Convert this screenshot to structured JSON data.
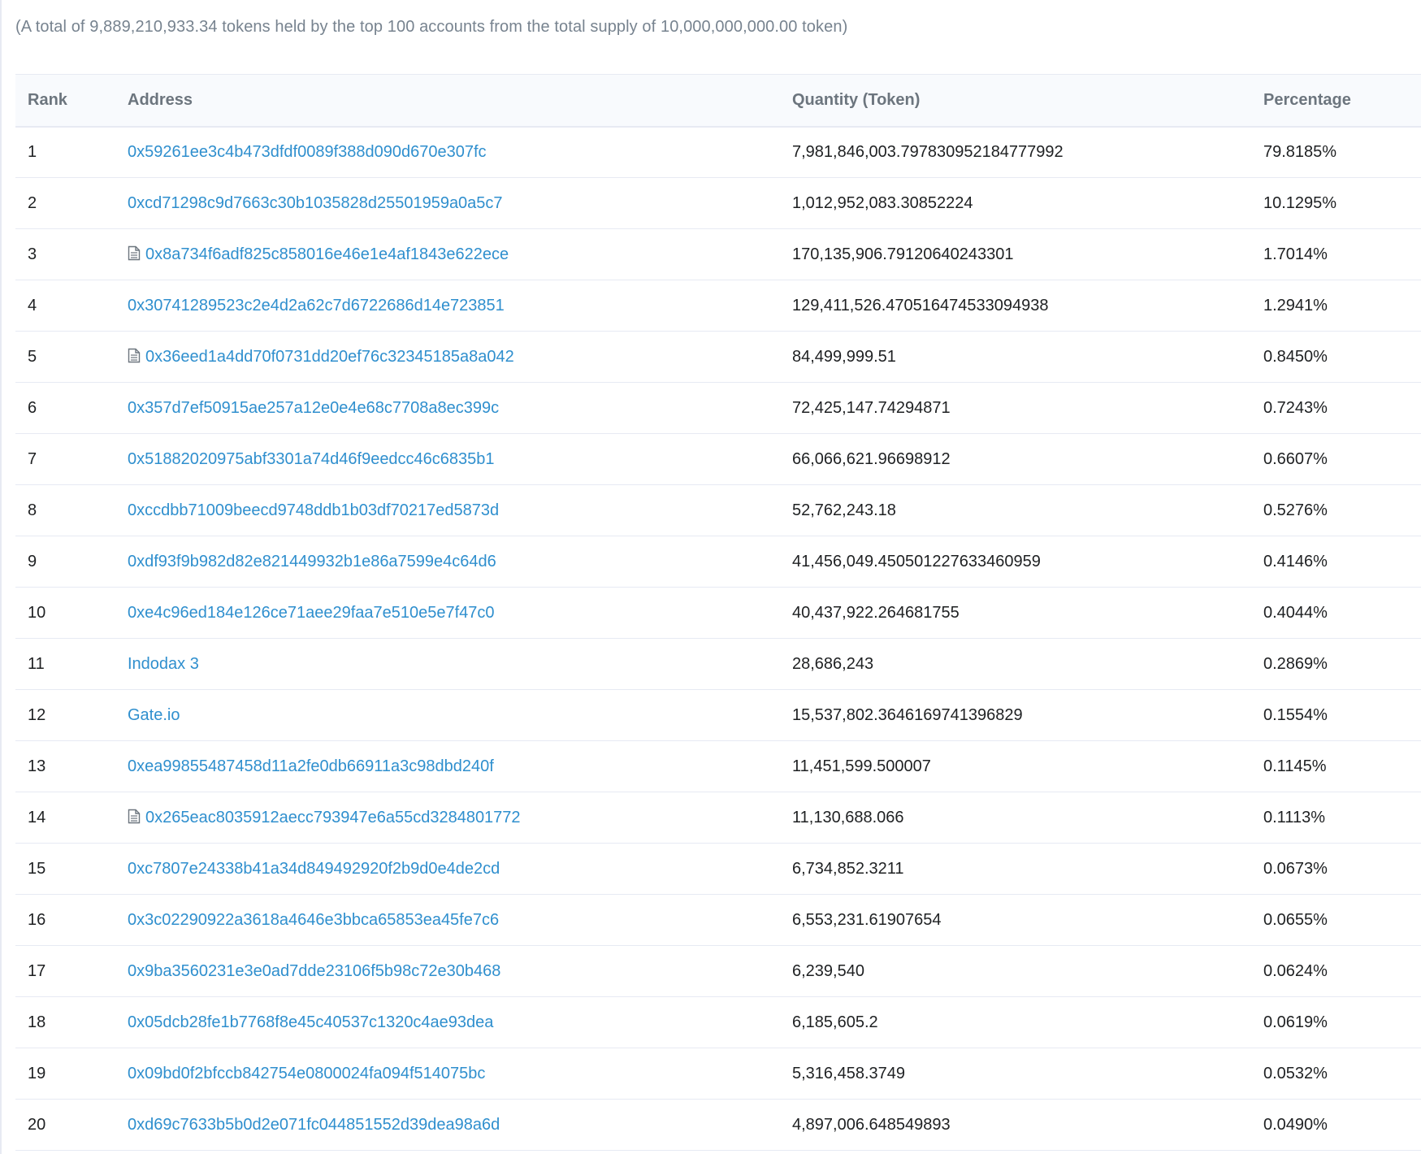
{
  "summary": "(A total of 9,889,210,933.34 tokens held by the top 100 accounts from the total supply of 10,000,000,000.00 token)",
  "table": {
    "headers": {
      "rank": "Rank",
      "address": "Address",
      "quantity": "Quantity (Token)",
      "percentage": "Percentage"
    },
    "rows": [
      {
        "rank": "1",
        "address": "0x59261ee3c4b473dfdf0089f388d090d670e307fc",
        "contract": false,
        "quantity": "7,981,846,003.797830952184777992",
        "percentage": "79.8185%"
      },
      {
        "rank": "2",
        "address": "0xcd71298c9d7663c30b1035828d25501959a0a5c7",
        "contract": false,
        "quantity": "1,012,952,083.30852224",
        "percentage": "10.1295%"
      },
      {
        "rank": "3",
        "address": "0x8a734f6adf825c858016e46e1e4af1843e622ece",
        "contract": true,
        "quantity": "170,135,906.79120640243301",
        "percentage": "1.7014%"
      },
      {
        "rank": "4",
        "address": "0x30741289523c2e4d2a62c7d6722686d14e723851",
        "contract": false,
        "quantity": "129,411,526.470516474533094938",
        "percentage": "1.2941%"
      },
      {
        "rank": "5",
        "address": "0x36eed1a4dd70f0731dd20ef76c32345185a8a042",
        "contract": true,
        "quantity": "84,499,999.51",
        "percentage": "0.8450%"
      },
      {
        "rank": "6",
        "address": "0x357d7ef50915ae257a12e0e4e68c7708a8ec399c",
        "contract": false,
        "quantity": "72,425,147.74294871",
        "percentage": "0.7243%"
      },
      {
        "rank": "7",
        "address": "0x51882020975abf3301a74d46f9eedcc46c6835b1",
        "contract": false,
        "quantity": "66,066,621.96698912",
        "percentage": "0.6607%"
      },
      {
        "rank": "8",
        "address": "0xccdbb71009beecd9748ddb1b03df70217ed5873d",
        "contract": false,
        "quantity": "52,762,243.18",
        "percentage": "0.5276%"
      },
      {
        "rank": "9",
        "address": "0xdf93f9b982d82e821449932b1e86a7599e4c64d6",
        "contract": false,
        "quantity": "41,456,049.450501227633460959",
        "percentage": "0.4146%"
      },
      {
        "rank": "10",
        "address": "0xe4c96ed184e126ce71aee29faa7e510e5e7f47c0",
        "contract": false,
        "quantity": "40,437,922.264681755",
        "percentage": "0.4044%"
      },
      {
        "rank": "11",
        "address": "Indodax 3",
        "contract": false,
        "quantity": "28,686,243",
        "percentage": "0.2869%"
      },
      {
        "rank": "12",
        "address": "Gate.io",
        "contract": false,
        "quantity": "15,537,802.3646169741396829",
        "percentage": "0.1554%"
      },
      {
        "rank": "13",
        "address": "0xea99855487458d11a2fe0db66911a3c98dbd240f",
        "contract": false,
        "quantity": "11,451,599.500007",
        "percentage": "0.1145%"
      },
      {
        "rank": "14",
        "address": "0x265eac8035912aecc793947e6a55cd3284801772",
        "contract": true,
        "quantity": "11,130,688.066",
        "percentage": "0.1113%"
      },
      {
        "rank": "15",
        "address": "0xc7807e24338b41a34d849492920f2b9d0e4de2cd",
        "contract": false,
        "quantity": "6,734,852.3211",
        "percentage": "0.0673%"
      },
      {
        "rank": "16",
        "address": "0x3c02290922a3618a4646e3bbca65853ea45fe7c6",
        "contract": false,
        "quantity": "6,553,231.61907654",
        "percentage": "0.0655%"
      },
      {
        "rank": "17",
        "address": "0x9ba3560231e3e0ad7dde23106f5b98c72e30b468",
        "contract": false,
        "quantity": "6,239,540",
        "percentage": "0.0624%"
      },
      {
        "rank": "18",
        "address": "0x05dcb28fe1b7768f8e45c40537c1320c4ae93dea",
        "contract": false,
        "quantity": "6,185,605.2",
        "percentage": "0.0619%"
      },
      {
        "rank": "19",
        "address": "0x09bd0f2bfccb842754e0800024fa094f514075bc",
        "contract": false,
        "quantity": "5,316,458.3749",
        "percentage": "0.0532%"
      },
      {
        "rank": "20",
        "address": "0xd69c7633b5b0d2e071fc044851552d39dea98a6d",
        "contract": false,
        "quantity": "4,897,006.648549893",
        "percentage": "0.0490%"
      }
    ]
  },
  "colors": {
    "link": "#2f8fce",
    "muted_text": "#77838f",
    "header_bg": "#f8fafd",
    "border": "#e7eaf3"
  },
  "icons": {
    "contract": "contract-file-icon"
  }
}
